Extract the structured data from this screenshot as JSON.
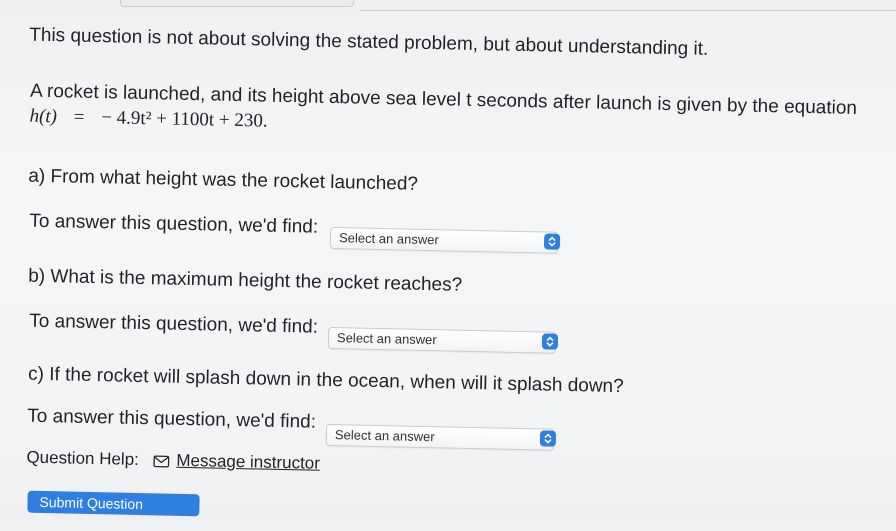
{
  "intro": "This question is not about solving the stated problem, but about understanding it.",
  "problem": "A rocket is launched, and its height above sea level t seconds after launch is given by the equation",
  "equation": {
    "lhs": "h(t)",
    "equals": "=",
    "rhs": "− 4.9t² + 1100t + 230."
  },
  "parts": [
    {
      "question": "a) From what height was the rocket launched?",
      "find_label": "To answer this question, we'd find:",
      "select_value": "Select an answer"
    },
    {
      "question": "b) What is the maximum height the rocket reaches?",
      "find_label": "To answer this question, we'd find:",
      "select_value": "Select an answer"
    },
    {
      "question": "c) If the rocket will splash down in the ocean, when will it splash down?",
      "find_label": "To answer this question, we'd find:",
      "select_value": "Select an answer"
    }
  ],
  "help": {
    "label": "Question Help:",
    "link": "Message instructor"
  },
  "submit_label": "Submit Question",
  "colors": {
    "accent": "#2f7fe0",
    "background": "#f2f3f5",
    "text": "#1f2226"
  }
}
